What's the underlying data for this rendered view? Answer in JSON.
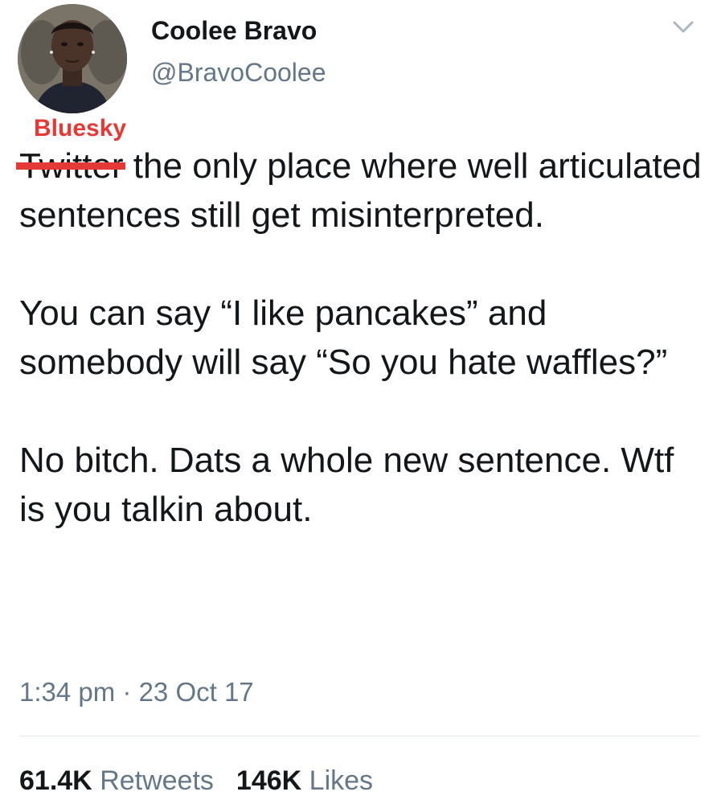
{
  "author": {
    "display_name": "Coolee Bravo",
    "handle": "@BravoCoolee"
  },
  "icons": {
    "avatar": "profile-photo",
    "menu": "chevron-down-icon"
  },
  "overlay": {
    "label": "Bluesky",
    "color": "#e53935"
  },
  "tweet": {
    "struck_word": "Twitter",
    "line1_rest": " the only place where well articulated sentences still get misinterpreted.",
    "paragraph2": "You can say “I like pancakes” and somebody will say “So you hate waffles?”",
    "paragraph3": "No bitch. Dats a whole new sentence. Wtf is you talkin about.",
    "timestamp": "1:34 pm · 23 Oct 17"
  },
  "stats": {
    "retweets_count": "61.4K",
    "retweets_label": "Retweets",
    "likes_count": "146K",
    "likes_label": "Likes"
  },
  "colors": {
    "text": "#14171a",
    "secondary": "#657786",
    "divider": "#e1e8ed",
    "annotation": "#e53935"
  }
}
